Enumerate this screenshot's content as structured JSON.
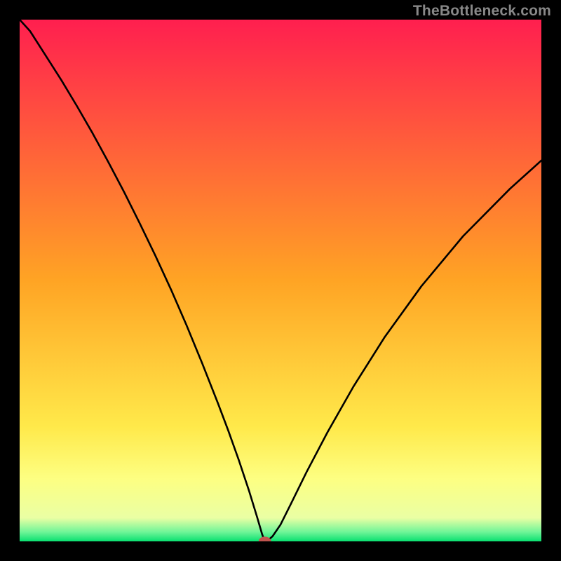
{
  "watermark": "TheBottleneck.com",
  "chart_data": {
    "type": "line",
    "title": "",
    "xlabel": "",
    "ylabel": "",
    "xlim": [
      0,
      100
    ],
    "ylim": [
      0,
      100
    ],
    "background_gradient_stops": [
      {
        "offset": 0.0,
        "color": "#ff1f4f"
      },
      {
        "offset": 0.5,
        "color": "#ffa424"
      },
      {
        "offset": 0.78,
        "color": "#ffe94a"
      },
      {
        "offset": 0.88,
        "color": "#fdff82"
      },
      {
        "offset": 0.955,
        "color": "#eaffa4"
      },
      {
        "offset": 0.982,
        "color": "#6ff598"
      },
      {
        "offset": 1.0,
        "color": "#09e070"
      }
    ],
    "curve": {
      "min_x": 47,
      "x": [
        0,
        2,
        5,
        8,
        11,
        14,
        17,
        20,
        23,
        26,
        29,
        32,
        35,
        38,
        40,
        42,
        44,
        45.5,
        46.5,
        47,
        47.5,
        48.5,
        50,
        52,
        55,
        59,
        64,
        70,
        77,
        85,
        94,
        100
      ],
      "y": [
        100,
        97.8,
        93.1,
        88.4,
        83.4,
        78.2,
        72.7,
        67.0,
        61.0,
        54.8,
        48.3,
        41.4,
        34.1,
        26.5,
        21.2,
        15.6,
        9.6,
        4.7,
        1.3,
        0.0,
        0.1,
        1.0,
        3.2,
        7.2,
        13.3,
        20.9,
        29.7,
        39.2,
        48.9,
        58.5,
        67.6,
        73.0
      ]
    },
    "marker": {
      "x": 47,
      "y": 0,
      "color": "#c0544f",
      "rx": 1.2,
      "ry": 0.9
    }
  }
}
